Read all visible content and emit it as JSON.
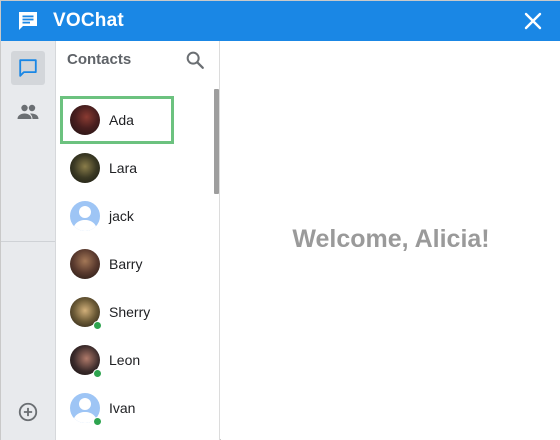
{
  "app": {
    "title": "VOChat",
    "brand_color": "#1a87e5",
    "logo_icon": "chat-bubble-icon",
    "close_icon": "close-icon"
  },
  "rail": {
    "items": [
      {
        "id": "chats",
        "icon": "chat-bubble-outline-icon",
        "active": true
      },
      {
        "id": "people",
        "icon": "people-icon",
        "active": false
      },
      {
        "id": "add",
        "icon": "add-circle-outline-icon",
        "active": false
      }
    ]
  },
  "contacts": {
    "title": "Contacts",
    "search_icon": "search-icon",
    "items": [
      {
        "name": "Ada",
        "online": false,
        "selected": true,
        "avatar_color": "#4a1f1f"
      },
      {
        "name": "Lara",
        "online": false,
        "selected": false,
        "avatar_color": "#3c3a24"
      },
      {
        "name": "jack",
        "online": false,
        "selected": false,
        "avatar_color": "#9ec5f5",
        "default_avatar": true
      },
      {
        "name": "Barry",
        "online": false,
        "selected": false,
        "avatar_color": "#5a3a2e"
      },
      {
        "name": "Sherry",
        "online": true,
        "selected": false,
        "avatar_color": "#6b5a36"
      },
      {
        "name": "Leon",
        "online": true,
        "selected": false,
        "avatar_color": "#3a2a2a"
      },
      {
        "name": "Ivan",
        "online": true,
        "selected": false,
        "avatar_color": "#9ec5f5",
        "default_avatar": true
      }
    ]
  },
  "main": {
    "welcome_text": "Welcome, Alicia!"
  },
  "colors": {
    "selected_outline": "#6cc27f",
    "online": "#2ea44f"
  }
}
